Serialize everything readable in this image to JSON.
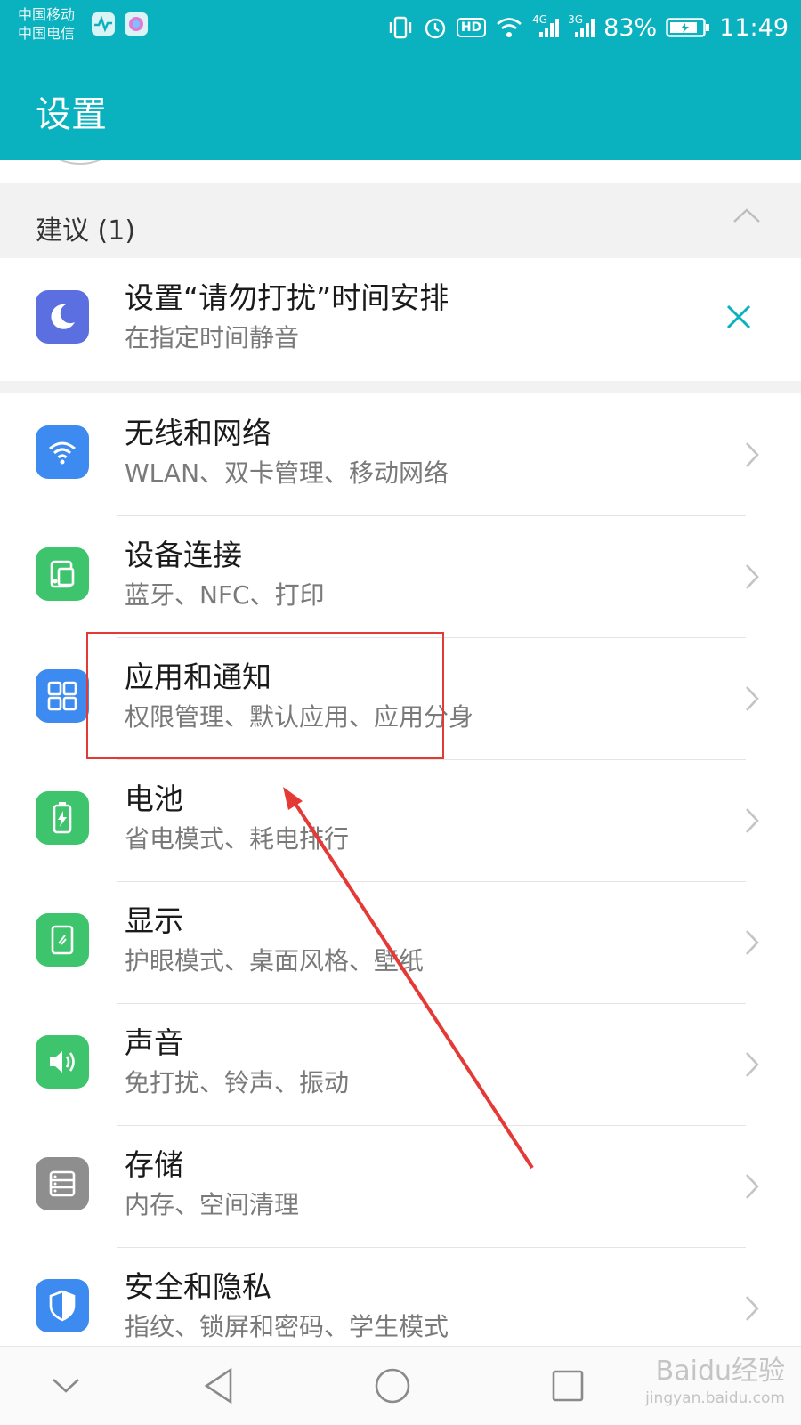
{
  "status_bar": {
    "carrier_1": "中国移动",
    "carrier_2": "中国电信",
    "network_1": "4G",
    "network_2": "3G",
    "battery": "83%",
    "time": "11:49",
    "hd_label": "HD"
  },
  "header": {
    "title": "设置"
  },
  "suggestions": {
    "title": "建议 (1)",
    "items": [
      {
        "title": "设置“请勿打扰”时间安排",
        "subtitle": "在指定时间静音",
        "icon": "moon-icon"
      }
    ]
  },
  "menu": {
    "items": [
      {
        "title": "无线和网络",
        "subtitle": "WLAN、双卡管理、移动网络",
        "icon": "wifi-icon",
        "color": "#3d8bf0"
      },
      {
        "title": "设备连接",
        "subtitle": "蓝牙、NFC、打印",
        "icon": "device-connection-icon",
        "color": "#3ec46d"
      },
      {
        "title": "应用和通知",
        "subtitle": "权限管理、默认应用、应用分身",
        "icon": "apps-grid-icon",
        "color": "#3d8bf0"
      },
      {
        "title": "电池",
        "subtitle": "省电模式、耗电排行",
        "icon": "battery-icon",
        "color": "#3ec46d"
      },
      {
        "title": "显示",
        "subtitle": "护眼模式、桌面风格、壁纸",
        "icon": "display-icon",
        "color": "#3ec46d"
      },
      {
        "title": "声音",
        "subtitle": "免打扰、铃声、振动",
        "icon": "speaker-icon",
        "color": "#3ec46d"
      },
      {
        "title": "存储",
        "subtitle": "内存、空间清理",
        "icon": "storage-icon",
        "color": "#8e8e8e"
      },
      {
        "title": "安全和隐私",
        "subtitle": "指纹、锁屏和密码、学生模式",
        "icon": "shield-icon",
        "color": "#3d8bf0"
      }
    ]
  },
  "colors": {
    "accent": "#0ab1be",
    "highlight": "#e53935"
  },
  "watermark": {
    "main": "Baidu经验",
    "sub": "jingyan.baidu.com"
  }
}
